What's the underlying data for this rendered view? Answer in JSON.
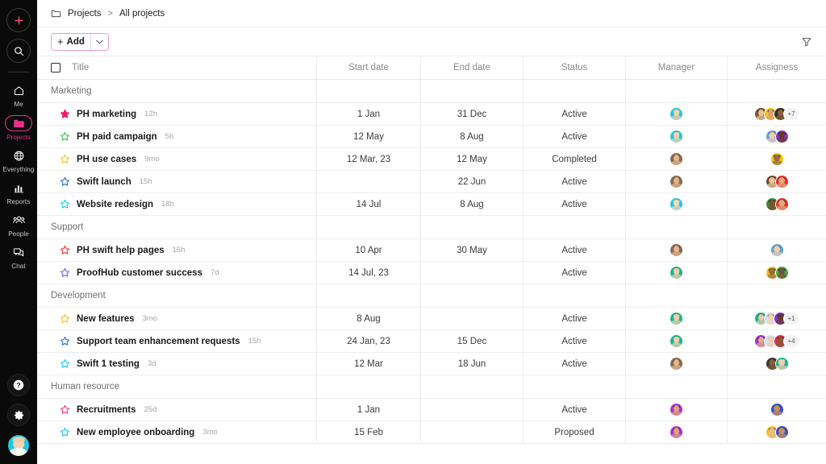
{
  "sidebar": {
    "top_actions": [
      {
        "name": "add",
        "icon": "plus-icon"
      },
      {
        "name": "search",
        "icon": "search-icon"
      }
    ],
    "items": [
      {
        "label": "Me",
        "icon": "home-icon",
        "active": false
      },
      {
        "label": "Projects",
        "icon": "folder-icon",
        "active": true
      },
      {
        "label": "Everything",
        "icon": "globe-icon",
        "active": false
      },
      {
        "label": "Reports",
        "icon": "bar-chart-icon",
        "active": false
      },
      {
        "label": "People",
        "icon": "people-icon",
        "active": false
      },
      {
        "label": "Chat",
        "icon": "chat-icon",
        "active": false
      }
    ],
    "bottom_actions": [
      {
        "name": "help",
        "icon": "question-icon"
      },
      {
        "name": "settings",
        "icon": "gear-icon"
      },
      {
        "name": "profile",
        "icon": "user-avatar"
      }
    ],
    "accent_color": "#e8308a"
  },
  "breadcrumb": {
    "folder_icon": "folder-icon",
    "root": "Projects",
    "separator": ">",
    "current": "All projects"
  },
  "toolbar": {
    "add_label": "Add",
    "add_plus": "+",
    "caret_icon": "chevron-down-icon",
    "filter_icon": "filter-icon"
  },
  "table": {
    "columns": [
      "Title",
      "Start date",
      "End date",
      "Status",
      "Manager",
      "Assigness"
    ],
    "groups": [
      {
        "name": "Marketing",
        "rows": [
          {
            "star": "#ef1b6b",
            "star_filled": true,
            "name": "PH marketing",
            "time": "12h",
            "start": "1 Jan",
            "end": "31 Dec",
            "status": "Active",
            "manager": {
              "bg": "#22c7e0",
              "hair": "#caa36a",
              "skin": "#f1c9a5"
            },
            "assignees": [
              {
                "bg": "#6b4a2f",
                "hair": "#3a2316",
                "skin": "#e8bb92"
              },
              {
                "bg": "#f5c518",
                "hair": "#2d2116",
                "skin": "#d9a172"
              },
              {
                "bg": "#2f3a2a",
                "hair": "#181008",
                "skin": "#8a5c3a"
              }
            ],
            "more": "+7"
          }
        ]
      }
    ],
    "rows": [
      {
        "type": "group",
        "name": "Marketing"
      },
      {
        "type": "item",
        "star": "#ef1b6b",
        "filled": true,
        "name": "PH marketing",
        "time": "12h",
        "start": "1 Jan",
        "end": "31 Dec",
        "status": "Active",
        "manager": {
          "bg": "#22c7e0",
          "hair": "#d6b079",
          "skin": "#f5d2ae"
        },
        "assignees": [
          {
            "bg": "#7a5436",
            "hair": "#3b2417",
            "skin": "#eac09a"
          },
          {
            "bg": "#f5c518",
            "hair": "#2a1d12",
            "skin": "#d8a273"
          },
          {
            "bg": "#2e3528",
            "hair": "#140d06",
            "skin": "#8d6040"
          }
        ],
        "more": "+7"
      },
      {
        "type": "item",
        "star": "#35c759",
        "filled": false,
        "name": "PH paid campaign",
        "time": "5h",
        "start": "12 May",
        "end": "8 Aug",
        "status": "Active",
        "manager": {
          "bg": "#22c7e0",
          "hair": "#d6b079",
          "skin": "#f5d2ae"
        },
        "assignees": [
          {
            "bg": "#4fa3e3",
            "hair": "#6b4a2c",
            "skin": "#f0cdab"
          },
          {
            "bg": "#8b2fd6",
            "hair": "#1a1008",
            "skin": "#5f4027"
          }
        ],
        "more": ""
      },
      {
        "type": "item",
        "star": "#f5c518",
        "filled": false,
        "name": "PH use cases",
        "time": "9mo",
        "start": "12 Mar, 23",
        "end": "12 May",
        "status": "Completed",
        "manager": {
          "bg": "#8a6a52",
          "hair": "#4e3524",
          "skin": "#e3b68e"
        },
        "assignees": [
          {
            "bg": "#f5c518",
            "hair": "#241709",
            "skin": "#9a6a42"
          }
        ],
        "more": ""
      },
      {
        "type": "item",
        "star": "#2f6fd0",
        "filled": false,
        "name": "Swift launch",
        "time": "15h",
        "start": "",
        "end": "22 Jun",
        "status": "Active",
        "manager": {
          "bg": "#8a6a52",
          "hair": "#4e3524",
          "skin": "#e3b68e"
        },
        "assignees": [
          {
            "bg": "#6e4a2e",
            "hair": "#3a2214",
            "skin": "#ecc49c"
          },
          {
            "bg": "#ef2b2b",
            "hair": "#2a1a10",
            "skin": "#e0ab7e"
          }
        ],
        "more": ""
      },
      {
        "type": "item",
        "star": "#1ec9e8",
        "filled": false,
        "name": "Website redesign",
        "time": "18h",
        "start": "14 Jul",
        "end": "8 Aug",
        "status": "Active",
        "manager": {
          "bg": "#22c7e0",
          "hair": "#e2c08c",
          "skin": "#f7d8b6"
        },
        "assignees": [
          {
            "bg": "#2f8f3a",
            "hair": "#150d06",
            "skin": "#7b4f30"
          },
          {
            "bg": "#ef2b2b",
            "hair": "#2a1a10",
            "skin": "#e0ab7e"
          }
        ],
        "more": ""
      },
      {
        "type": "group",
        "name": "Support"
      },
      {
        "type": "item",
        "star": "#ef3b2b",
        "filled": false,
        "name": "PH swift help pages",
        "time": "15h",
        "start": "10 Apr",
        "end": "30 May",
        "status": "Active",
        "manager": {
          "bg": "#8a6a52",
          "hair": "#4e3524",
          "skin": "#e3b68e"
        },
        "assignees": [
          {
            "bg": "#4fa3e3",
            "hair": "#6b4a2c",
            "skin": "#f0cdab"
          }
        ],
        "more": ""
      },
      {
        "type": "item",
        "star": "#7b5cf0",
        "filled": false,
        "name": "ProofHub customer success",
        "time": "7d",
        "start": "14 Jul, 23",
        "end": "",
        "status": "Active",
        "manager": {
          "bg": "#17b39b",
          "hair": "#d8b07a",
          "skin": "#f2cfa9"
        },
        "assignees": [
          {
            "bg": "#f5c518",
            "hair": "#241709",
            "skin": "#9a6a42"
          },
          {
            "bg": "#3fae53",
            "hair": "#17100a",
            "skin": "#7a5032"
          }
        ],
        "more": ""
      },
      {
        "type": "group",
        "name": "Development"
      },
      {
        "type": "item",
        "star": "#f5c518",
        "filled": false,
        "name": "New features",
        "time": "3mo",
        "start": "8 Aug",
        "end": "",
        "status": "Active",
        "manager": {
          "bg": "#17b39b",
          "hair": "#d8b07a",
          "skin": "#f2cfa9"
        },
        "assignees": [
          {
            "bg": "#17b39b",
            "hair": "#5a3a22",
            "skin": "#edc8a3"
          },
          {
            "bg": "#cfe3f5",
            "hair": "#6b4a2c",
            "skin": "#f2d2b0"
          },
          {
            "bg": "#8b2fd6",
            "hair": "#1a1008",
            "skin": "#5f4027"
          }
        ],
        "more": "+1"
      },
      {
        "type": "item",
        "star": "#2f6fd0",
        "filled": false,
        "name": "Support team enhancement requests",
        "time": "15h",
        "start": "24 Jan, 23",
        "end": "15 Dec",
        "status": "Active",
        "manager": {
          "bg": "#17b39b",
          "hair": "#d8b07a",
          "skin": "#f2cfa9"
        },
        "assignees": [
          {
            "bg": "#a52fd6",
            "hair": "#1d1209",
            "skin": "#e2b085"
          },
          {
            "bg": "#cfe3f5",
            "hair": "#b9b2aa",
            "skin": "#f0d0ae"
          },
          {
            "bg": "#e02a5a",
            "hair": "#1a1008",
            "skin": "#8a5c3a"
          }
        ],
        "more": "+4"
      },
      {
        "type": "item",
        "star": "#1ec9e8",
        "filled": false,
        "name": "Swift 1 testing",
        "time": "3d",
        "start": "12 Mar",
        "end": "18 Jun",
        "status": "Active",
        "manager": {
          "bg": "#8a6a52",
          "hair": "#4e3524",
          "skin": "#e3b68e"
        },
        "assignees": [
          {
            "bg": "#2f3a2a",
            "hair": "#150d06",
            "skin": "#8a5c3a"
          },
          {
            "bg": "#17b39b",
            "hair": "#d8b07a",
            "skin": "#f2cfa9"
          }
        ],
        "more": ""
      },
      {
        "type": "group",
        "name": "Human resource"
      },
      {
        "type": "item",
        "star": "#f03a8c",
        "filled": false,
        "name": "Recruitments",
        "time": "25d",
        "start": "1 Jan",
        "end": "",
        "status": "Active",
        "manager": {
          "bg": "#b32fd6",
          "hair": "#1d1209",
          "skin": "#d9a87c"
        },
        "assignees": [
          {
            "bg": "#2f4fd6",
            "hair": "#3a2214",
            "skin": "#c98f5f"
          }
        ],
        "more": ""
      },
      {
        "type": "item",
        "star": "#1ec9e8",
        "filled": false,
        "name": "New employee onboarding",
        "time": "3mo",
        "start": "15 Feb",
        "end": "",
        "status": "Proposed",
        "manager": {
          "bg": "#b32fd6",
          "hair": "#1d1209",
          "skin": "#d9a87c"
        },
        "assignees": [
          {
            "bg": "#f5c518",
            "hair": "#3b2a18",
            "skin": "#e6bb90"
          },
          {
            "bg": "#2f4fd6",
            "hair": "#3a2214",
            "skin": "#c98f5f"
          }
        ],
        "more": ""
      }
    ]
  }
}
